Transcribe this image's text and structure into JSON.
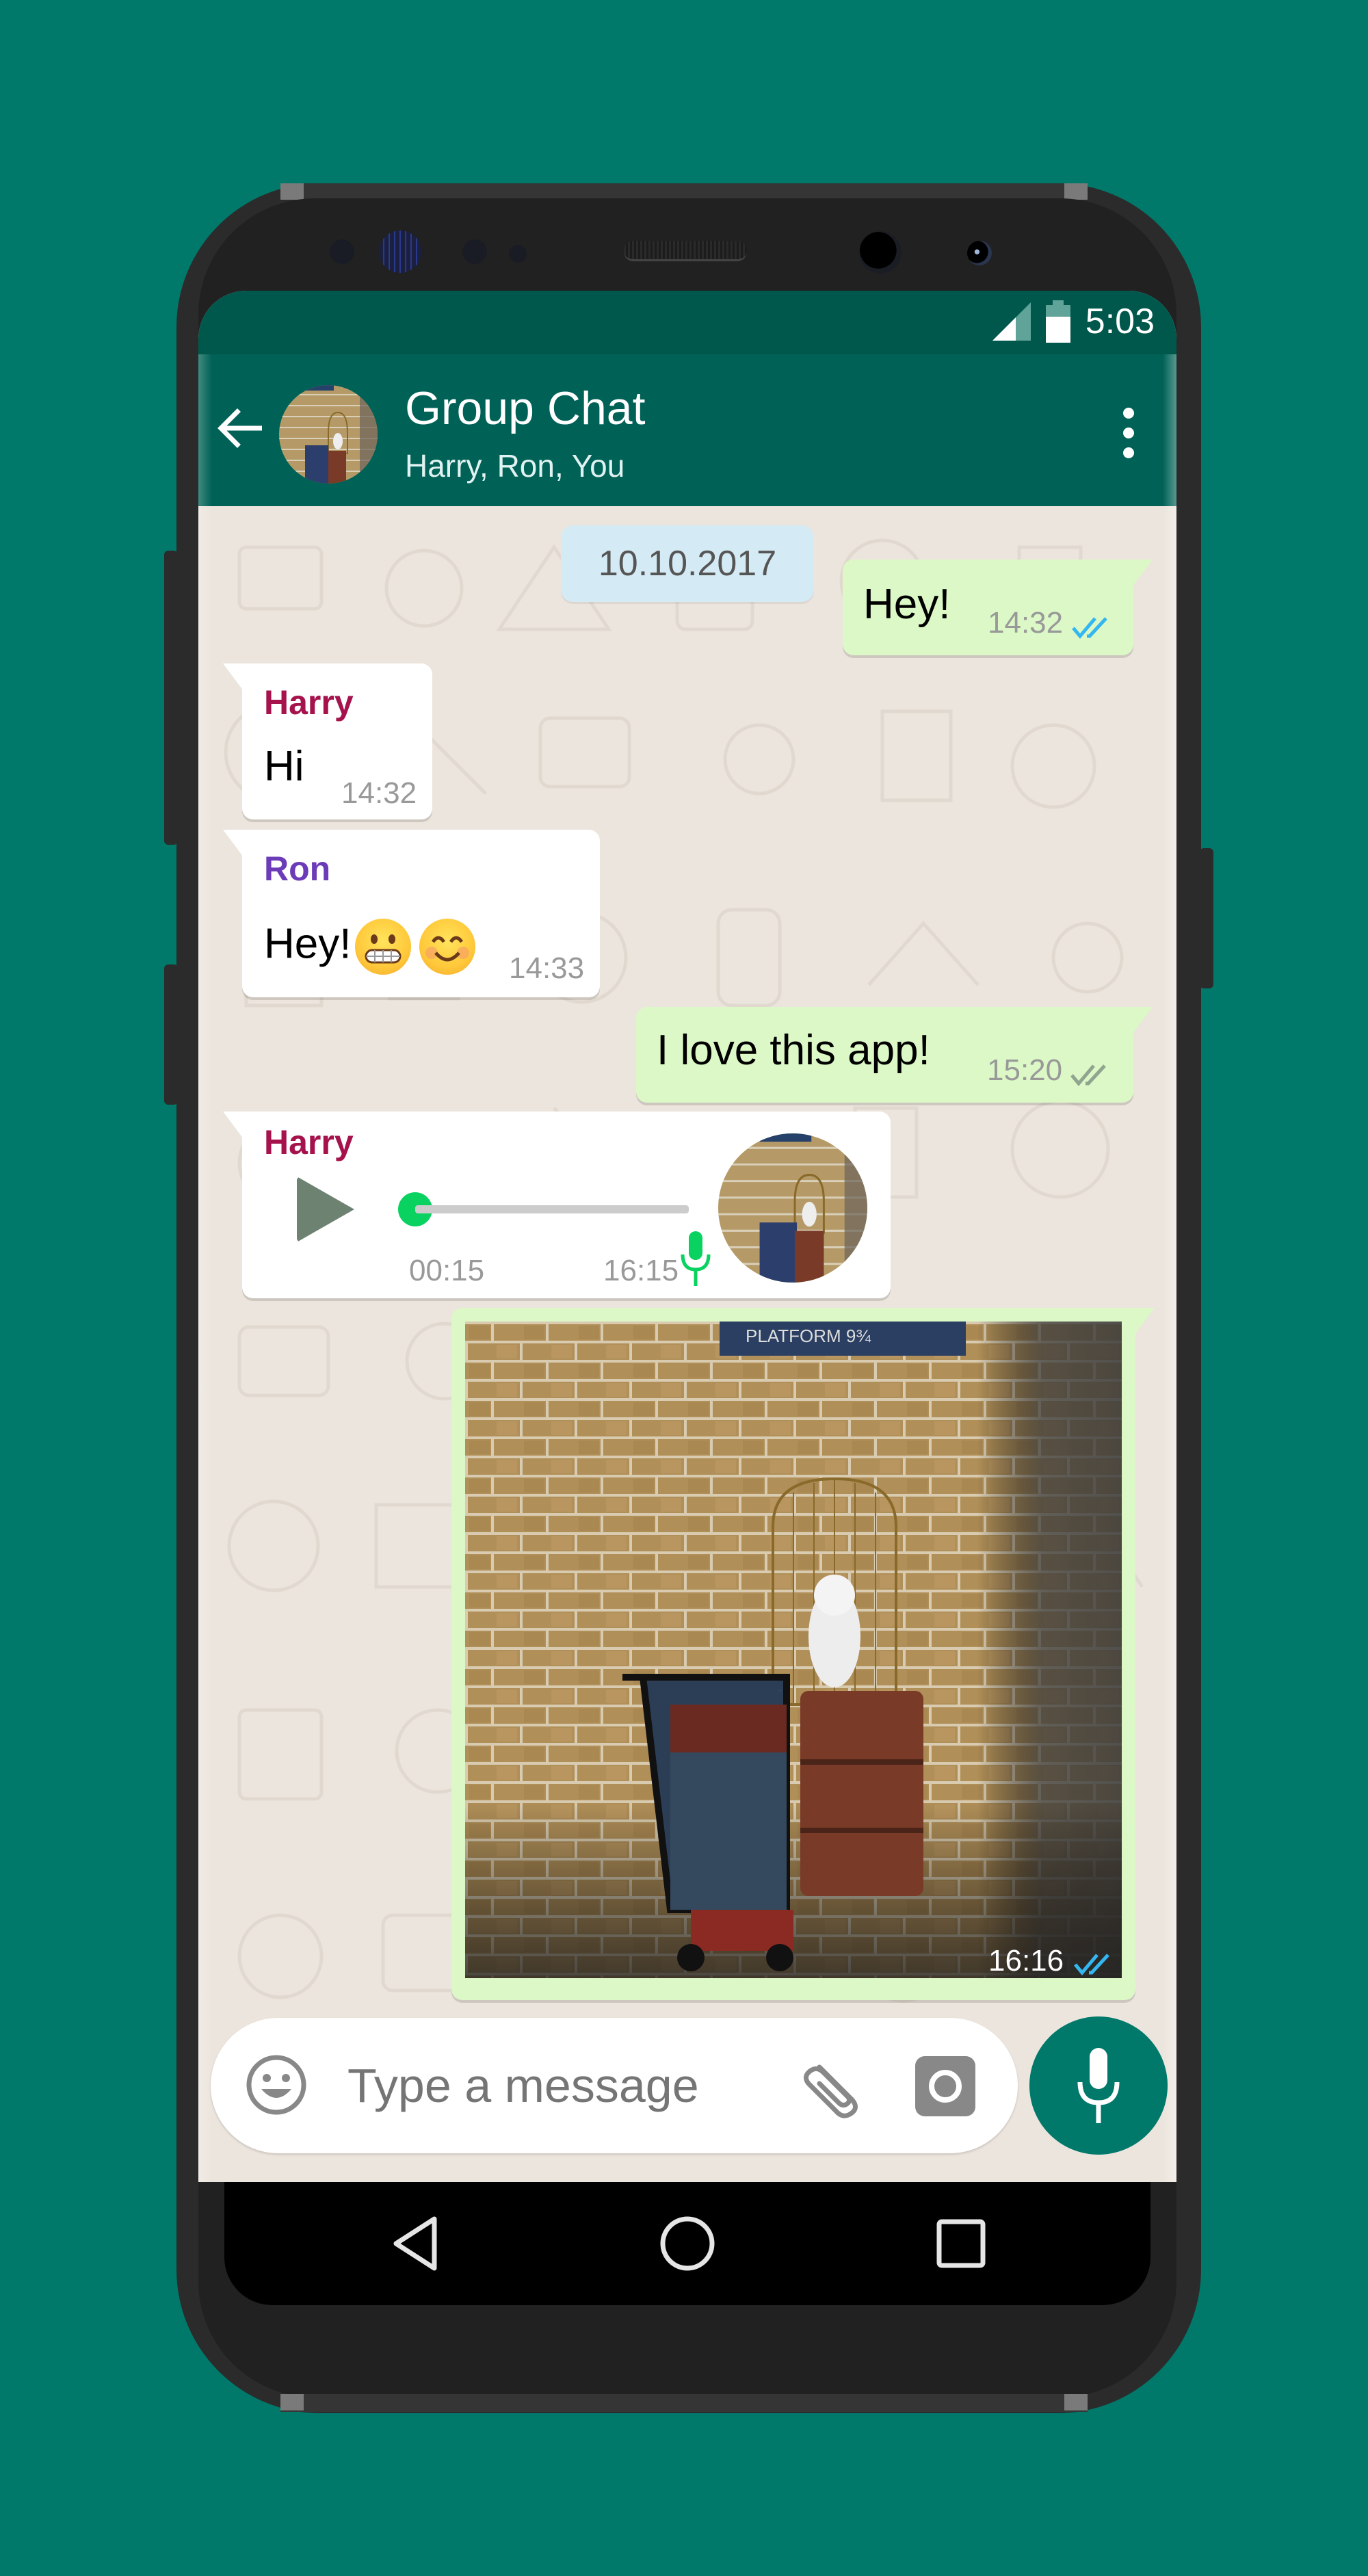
{
  "status_bar": {
    "time": "5:03",
    "icons": [
      "signal-icon",
      "battery-icon"
    ]
  },
  "app_bar": {
    "back_icon": "arrow-left-icon",
    "title": "Group Chat",
    "subtitle": "Harry, Ron, You",
    "menu_icon": "more-vert-icon"
  },
  "chat": {
    "date_separator": "10.10.2017",
    "messages": [
      {
        "direction": "outgoing",
        "text": "Hey!",
        "time": "14:32",
        "status": "read",
        "tick_color": "#34B7F1"
      },
      {
        "direction": "incoming",
        "sender": "Harry",
        "sender_color": "#A5124C",
        "text": "Hi",
        "time": "14:32"
      },
      {
        "direction": "incoming",
        "sender": "Ron",
        "sender_color": "#6C3BB8",
        "text": "Hey!",
        "emoji": [
          "grimacing-face-emoji",
          "smiling-face-emoji"
        ],
        "time": "14:33"
      },
      {
        "direction": "outgoing",
        "text": "I love this app!",
        "time": "15:20",
        "status": "delivered",
        "tick_color": "#8FA58F"
      },
      {
        "direction": "incoming",
        "sender": "Harry",
        "sender_color": "#A5124C",
        "type": "voice",
        "duration": "00:15",
        "time": "16:15",
        "progress": 0
      },
      {
        "direction": "outgoing",
        "type": "image",
        "image_desc": "Platform 9¾ brick wall with owl cage and luggage trolley",
        "time": "16:16",
        "status": "read",
        "tick_color": "#34B7F1"
      }
    ]
  },
  "composer": {
    "placeholder": "Type a message",
    "emoji_icon": "emoji-icon",
    "attach_icon": "paperclip-icon",
    "camera_icon": "camera-icon",
    "mic_icon": "microphone-icon"
  },
  "nav_bar": {
    "buttons": [
      "back-triangle-icon",
      "home-circle-icon",
      "recents-square-icon"
    ]
  },
  "colors": {
    "background": "#00796B",
    "status_bar": "#00574B",
    "app_bar": "#006156",
    "chat_bg": "#ECE5DD",
    "outgoing_bubble": "#DCF8C6",
    "incoming_bubble": "#FFFFFF",
    "date_chip": "#D4EAF4",
    "voice_accent": "#09D261"
  }
}
